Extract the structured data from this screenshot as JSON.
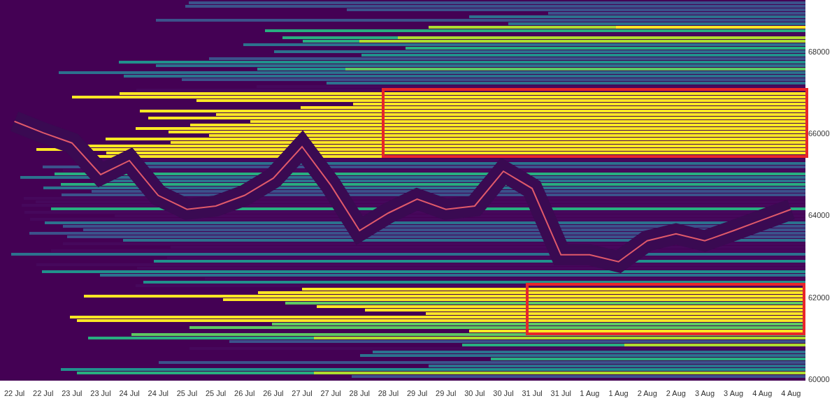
{
  "chart": {
    "chart_data": {
      "type": "line",
      "categories": [
        "22 Jul",
        "22 Jul",
        "23 Jul",
        "23 Jul",
        "24 Jul",
        "24 Jul",
        "25 Jul",
        "25 Jul",
        "26 Jul",
        "26 Jul",
        "27 Jul",
        "27 Jul",
        "28 Jul",
        "28 Jul",
        "29 Jul",
        "29 Jul",
        "30 Jul",
        "30 Jul",
        "31 Jul",
        "31 Jul",
        "1 Aug",
        "1 Aug",
        "2 Aug",
        "2 Aug",
        "3 Aug",
        "3 Aug",
        "4 Aug",
        "4 Aug"
      ],
      "series": [
        {
          "color": "#e05a6a",
          "values": [
            66300,
            66020,
            65770,
            65000,
            65340,
            64490,
            64150,
            64230,
            64490,
            64910,
            65680,
            64740,
            63630,
            64060,
            64400,
            64150,
            64230,
            65080,
            64660,
            63040,
            63040,
            62870,
            63380,
            63550,
            63380,
            63630,
            63890,
            64150
          ]
        }
      ],
      "ylim": [
        59966,
        69262
      ],
      "yticks": [
        68000,
        66000,
        64000,
        62000,
        60000
      ]
    }
  }
}
